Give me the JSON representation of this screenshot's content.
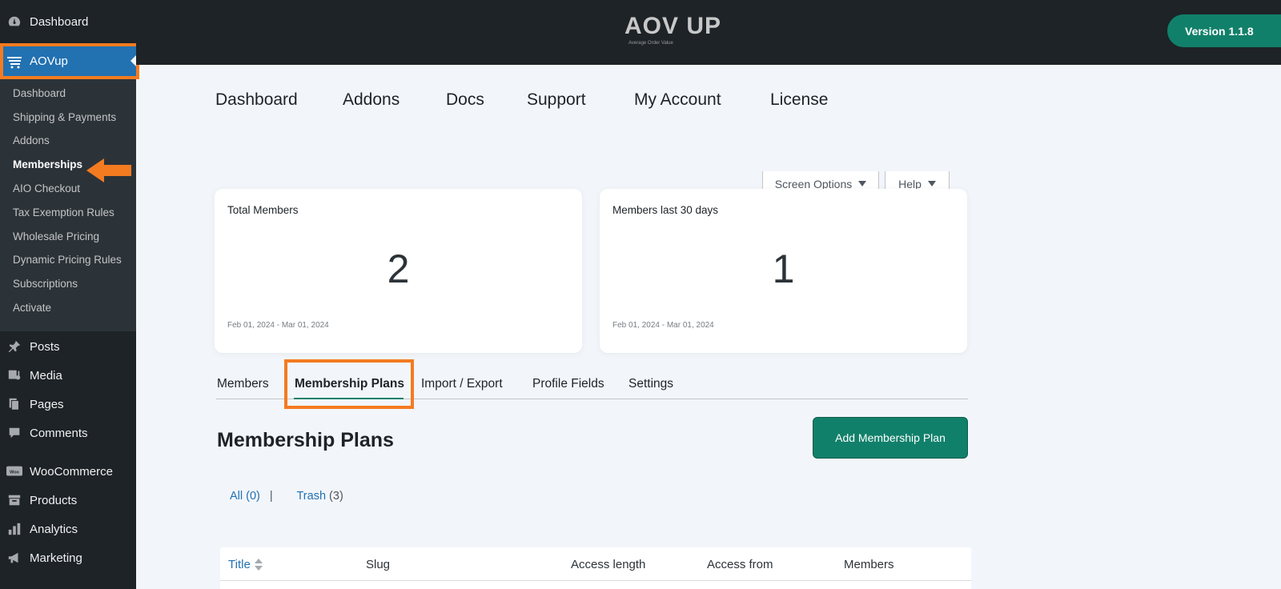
{
  "sidebar": {
    "top_items": [
      {
        "label": "Dashboard",
        "icon": "gauge-icon"
      }
    ],
    "active_item": {
      "label": "AOVup",
      "icon": "cart-icon"
    },
    "submenu": [
      "Dashboard",
      "Shipping & Payments",
      "Addons",
      "Memberships",
      "AIO Checkout",
      "Tax Exemption Rules",
      "Wholesale Pricing",
      "Dynamic Pricing Rules",
      "Subscriptions",
      "Activate"
    ],
    "current_submenu": "Memberships",
    "bottom_items": [
      {
        "label": "Posts",
        "icon": "pin-icon"
      },
      {
        "label": "Media",
        "icon": "media-icon"
      },
      {
        "label": "Pages",
        "icon": "pages-icon"
      },
      {
        "label": "Comments",
        "icon": "comment-icon"
      },
      {
        "label": "WooCommerce",
        "icon": "woo-icon"
      },
      {
        "label": "Products",
        "icon": "archive-icon"
      },
      {
        "label": "Analytics",
        "icon": "bar-chart-icon"
      },
      {
        "label": "Marketing",
        "icon": "megaphone-icon"
      }
    ]
  },
  "header": {
    "logo_text": "AOV UP",
    "logo_tagline": "Average Order Value",
    "version": "Version 1.1.8"
  },
  "main_nav": [
    "Dashboard",
    "Addons",
    "Docs",
    "Support",
    "My Account",
    "License"
  ],
  "screen_options": {
    "screen_options_label": "Screen Options",
    "help_label": "Help"
  },
  "cards": [
    {
      "label": "Total Members",
      "value": "2",
      "range": "Feb 01, 2024 - Mar 01, 2024"
    },
    {
      "label": "Members last 30 days",
      "value": "1",
      "range": "Feb 01, 2024 - Mar 01, 2024"
    }
  ],
  "tabs": [
    "Members",
    "Membership Plans",
    "Import / Export",
    "Profile Fields",
    "Settings"
  ],
  "active_tab": "Membership Plans",
  "section": {
    "title": "Membership Plans",
    "add_button": "Add Membership Plan"
  },
  "filters": {
    "all_label": "All",
    "all_count": "(0)",
    "separator": "|",
    "trash_label": "Trash",
    "trash_count": "(3)"
  },
  "table": {
    "columns": [
      "Title",
      "Slug",
      "Access length",
      "Access from",
      "Members"
    ]
  },
  "colors": {
    "accent": "#11806a",
    "highlight": "#f47b20",
    "wp_blue": "#2271b1",
    "sidebar": "#1d2327"
  }
}
